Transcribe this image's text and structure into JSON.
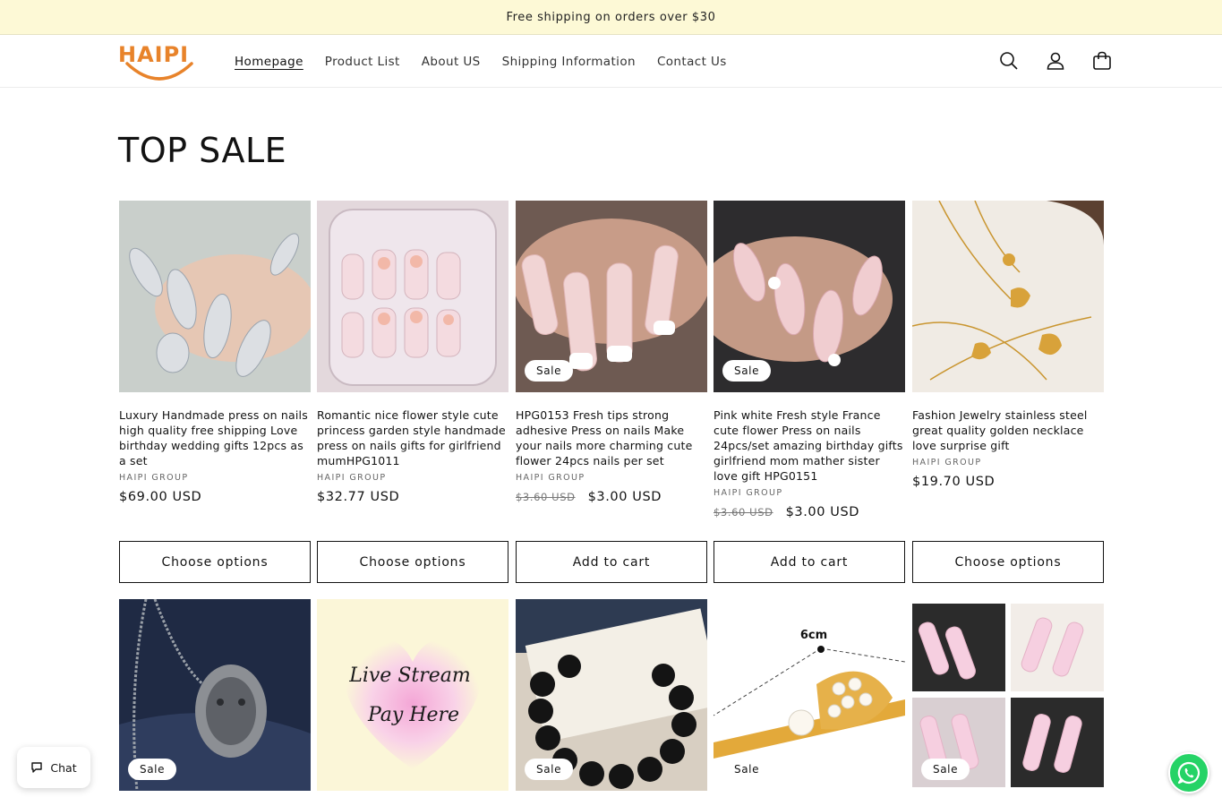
{
  "announcement": {
    "text": "Free shipping on orders over $30"
  },
  "header": {
    "logo_text": "HAIPI",
    "nav": [
      {
        "label": "Homepage",
        "active": true
      },
      {
        "label": "Product List",
        "active": false
      },
      {
        "label": "About US",
        "active": false
      },
      {
        "label": "Shipping Information",
        "active": false
      },
      {
        "label": "Contact Us",
        "active": false
      }
    ],
    "icons": [
      "search-icon",
      "account-icon",
      "cart-icon"
    ]
  },
  "section": {
    "title": "TOP SALE"
  },
  "products": [
    {
      "title": "Luxury Handmade press on nails high quality free shipping Love birthday wedding gifts 12pcs as a set",
      "vendor": "HAIPI GROUP",
      "price": "$69.00 USD",
      "old_price": "",
      "sale": false,
      "button": "Choose options"
    },
    {
      "title": "Romantic nice flower style cute princess garden style handmade press on nails gifts for girlfriend mumHPG1011",
      "vendor": "HAIPI GROUP",
      "price": "$32.77 USD",
      "old_price": "",
      "sale": false,
      "button": "Choose options"
    },
    {
      "title": "HPG0153 Fresh tips strong adhesive Press on nails Make your nails more charming cute flower 24pcs nails per set",
      "vendor": "HAIPI GROUP",
      "price": "$3.00 USD",
      "old_price": "$3.60 USD",
      "sale": true,
      "button": "Add to cart"
    },
    {
      "title": "Pink white Fresh style France cute flower Press on nails 24pcs/set amazing birthday gifts girlfriend mom mather sister love gift HPG0151",
      "vendor": "HAIPI GROUP",
      "price": "$3.00 USD",
      "old_price": "$3.60 USD",
      "sale": true,
      "button": "Add to cart"
    },
    {
      "title": "Fashion Jewelry stainless steel great quality golden necklace love surprise gift",
      "vendor": "HAIPI GROUP",
      "price": "$19.70 USD",
      "old_price": "",
      "sale": false,
      "button": "Choose options"
    }
  ],
  "row2": [
    {
      "sale": true,
      "badge": "Sale"
    },
    {
      "sale": false,
      "badge": "",
      "image_text_1": "Live Stream",
      "image_text_2": "Pay Here"
    },
    {
      "sale": true,
      "badge": "Sale"
    },
    {
      "sale": true,
      "badge": "Sale",
      "image_text_1": "6cm"
    },
    {
      "sale": true,
      "badge": "Sale"
    }
  ],
  "sale_badge": "Sale",
  "chat": {
    "label": "Chat"
  }
}
